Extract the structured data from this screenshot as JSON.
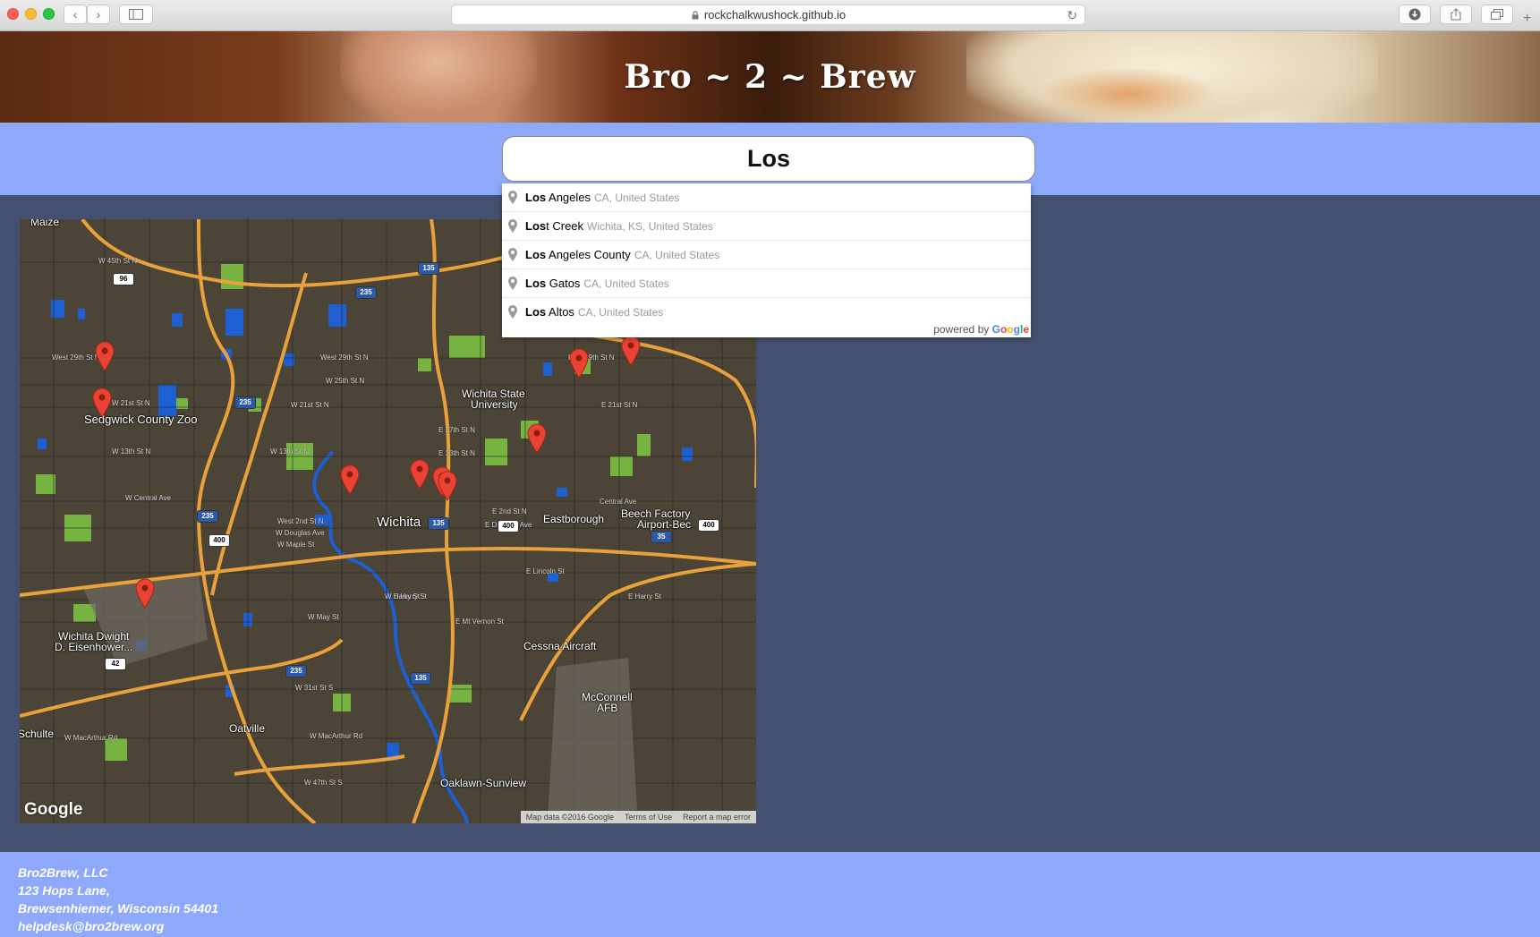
{
  "browser": {
    "url": "rockchalkwushock.github.io"
  },
  "site": {
    "title": "Bro ~ 2 ~ Brew"
  },
  "search": {
    "value": "Los"
  },
  "autocomplete": {
    "items": [
      {
        "match": "Los",
        "rest": " Angeles",
        "secondary": "CA, United States"
      },
      {
        "match": "Los",
        "rest": "t Creek",
        "secondary": "Wichita, KS, United States"
      },
      {
        "match": "Los",
        "rest": " Angeles County",
        "secondary": "CA, United States"
      },
      {
        "match": "Los",
        "rest": " Gatos",
        "secondary": "CA, United States"
      },
      {
        "match": "Los",
        "rest": " Altos",
        "secondary": "CA, United States"
      }
    ],
    "powered_by": "powered by",
    "google": [
      "G",
      "o",
      "o",
      "g",
      "l",
      "e"
    ]
  },
  "map": {
    "labels": {
      "maize": "Maize",
      "sedgwick_zoo": "Sedgwick County Zoo",
      "wsu": "Wichita State",
      "wsu2": "University",
      "wichita": "Wichita",
      "eastborough": "Eastborough",
      "beech": "Beech Factory",
      "beech2": "Airport-Bec",
      "eisenhower": "Wichita Dwight",
      "eisenhower2": "D. Eisenhower...",
      "cessna": "Cessna Aircraft",
      "mcconnell": "McConnell",
      "mcconnell2": "AFB",
      "oatville": "Oatville",
      "oaklawn": "Oaklawn-Sunview",
      "schulte": "Schulte"
    },
    "streets": {
      "w45": "W 45th St N",
      "w29": "West 29th St N",
      "w25": "W 25th St N",
      "w21": "W 21st St N",
      "w21b": "W 21st St N",
      "w13": "W 13th St N",
      "w13b": "W 13th St N",
      "wcentral": "W Central Ave",
      "w2nd": "West 2nd St N",
      "wdouglas": "W Douglas Ave",
      "wmaple": "W Maple St",
      "e17": "E 17th St N",
      "e13": "E 13th St N",
      "e2nd": "E 2nd St N",
      "edouglas": "E Douglas Ave",
      "elincoln": "E Lincoln St",
      "eharry": "E Harry St",
      "emtvernon": "E Mt Vernon St",
      "wmay": "W May St",
      "w31": "W 31st St S",
      "wmacarthur": "W MacArthur Rd",
      "w47": "W 47th St S",
      "east29": "East 29th St N",
      "e21": "E 21st St N",
      "centralave": "Central Ave",
      "wharry": "W Harry St"
    },
    "shields": [
      "96",
      "235",
      "135",
      "235",
      "235",
      "400",
      "135",
      "400",
      "400",
      "35",
      "42",
      "235",
      "135"
    ],
    "google_logo": "Google",
    "attribution": {
      "data": "Map data ©2016 Google",
      "terms": "Terms of Use",
      "report": "Report a map error"
    },
    "markers": 11
  },
  "footer": {
    "company": "Bro2Brew, LLC",
    "address1": "123 Hops Lane,",
    "address2": "Brewsenhiemer, Wisconsin 54401",
    "email": "helpdesk@bro2brew.org"
  }
}
